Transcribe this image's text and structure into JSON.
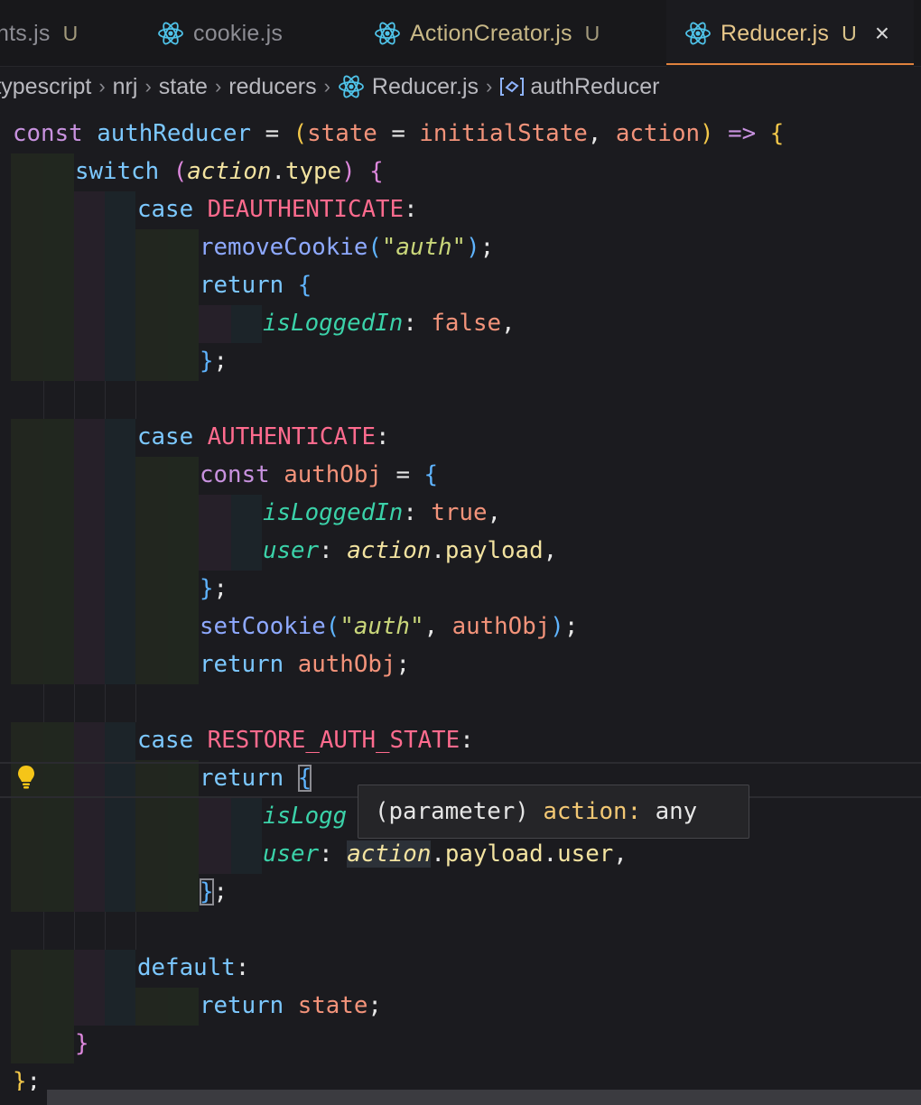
{
  "tabs": [
    {
      "label": "nts.js",
      "status": "U",
      "icon": "none",
      "active": false
    },
    {
      "label": "cookie.js",
      "status": "",
      "icon": "react-icon",
      "active": false
    },
    {
      "label": "ActionCreator.js",
      "status": "U",
      "icon": "react-icon",
      "active": false
    },
    {
      "label": "Reducer.js",
      "status": "U",
      "icon": "react-icon",
      "active": true,
      "close": "×"
    }
  ],
  "breadcrumb": {
    "items": [
      "-typescript",
      "nrj",
      "state",
      "reducers",
      "Reducer.js",
      "authReducer"
    ],
    "separator": "›"
  },
  "code": {
    "lines": [
      "const authReducer = (state = initialState, action) => {",
      "  switch (action.type) {",
      "    case DEAUTHENTICATE:",
      "      removeCookie(\"auth\");",
      "      return {",
      "        isLoggedIn: false,",
      "      };",
      "",
      "    case AUTHENTICATE:",
      "      const authObj = {",
      "        isLoggedIn: true,",
      "        user: action.payload,",
      "      };",
      "      setCookie(\"auth\", authObj);",
      "      return authObj;",
      "",
      "    case RESTORE_AUTH_STATE:",
      "      return {",
      "        isLogg",
      "        user: action.payload.user,",
      "      };",
      "",
      "    default:",
      "      return state;",
      "  }",
      "};"
    ]
  },
  "hover": {
    "prefix": "(parameter)",
    "name": "action",
    "colon": ":",
    "type": "any"
  },
  "colors": {
    "keyword": "#c892df",
    "function": "#7cc8ff",
    "constant": "#ff6b8e",
    "property": "#3bd2a9",
    "string": "#c9d67a",
    "active_tab_accent": "#e0823d"
  }
}
